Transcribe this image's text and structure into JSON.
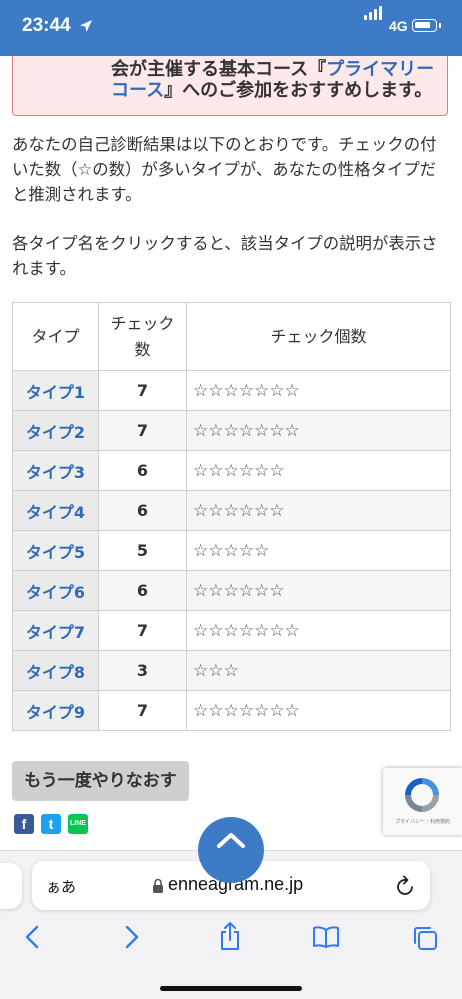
{
  "status_bar": {
    "time": "23:44",
    "network": "4G"
  },
  "notice": {
    "line1_text": "会が主催する基本コース『",
    "line1_link": "プライマリー",
    "line2_link": "コース",
    "line2_text": "』へのご参加をおすすめします。"
  },
  "intro": {
    "para1": "あなたの自己診断結果は以下のとおりです。チェックの付いた数（☆の数）が多いタイプが、あなたの性格タイプだと推測されます。",
    "para2": "各タイプ名をクリックすると、該当タイプの説明が表示されます。"
  },
  "table": {
    "headers": {
      "type": "タイプ",
      "count_line1": "チェック",
      "count_line2": "数",
      "stars": "チェック個数"
    },
    "rows": [
      {
        "type": "タイプ1",
        "count": "7",
        "stars": "☆☆☆☆☆☆☆"
      },
      {
        "type": "タイプ2",
        "count": "7",
        "stars": "☆☆☆☆☆☆☆"
      },
      {
        "type": "タイプ3",
        "count": "6",
        "stars": "☆☆☆☆☆☆"
      },
      {
        "type": "タイプ4",
        "count": "6",
        "stars": "☆☆☆☆☆☆"
      },
      {
        "type": "タイプ5",
        "count": "5",
        "stars": "☆☆☆☆☆"
      },
      {
        "type": "タイプ6",
        "count": "6",
        "stars": "☆☆☆☆☆☆"
      },
      {
        "type": "タイプ7",
        "count": "7",
        "stars": "☆☆☆☆☆☆☆"
      },
      {
        "type": "タイプ8",
        "count": "3",
        "stars": "☆☆☆"
      },
      {
        "type": "タイプ9",
        "count": "7",
        "stars": "☆☆☆☆☆☆☆"
      }
    ]
  },
  "retry_button": "もう一度やりなおす",
  "social": {
    "facebook": "f",
    "twitter": "t",
    "line": "LINE"
  },
  "recaptcha": {
    "text": "プライバシー・利用規約"
  },
  "browser": {
    "aa": "ぁあ",
    "url": "enneagram.ne.jp"
  },
  "colors": {
    "header_blue": "#3d7bc6",
    "link_blue": "#2d6bb8",
    "notice_bg": "#fde9e9",
    "notice_border": "#e07c7c"
  }
}
